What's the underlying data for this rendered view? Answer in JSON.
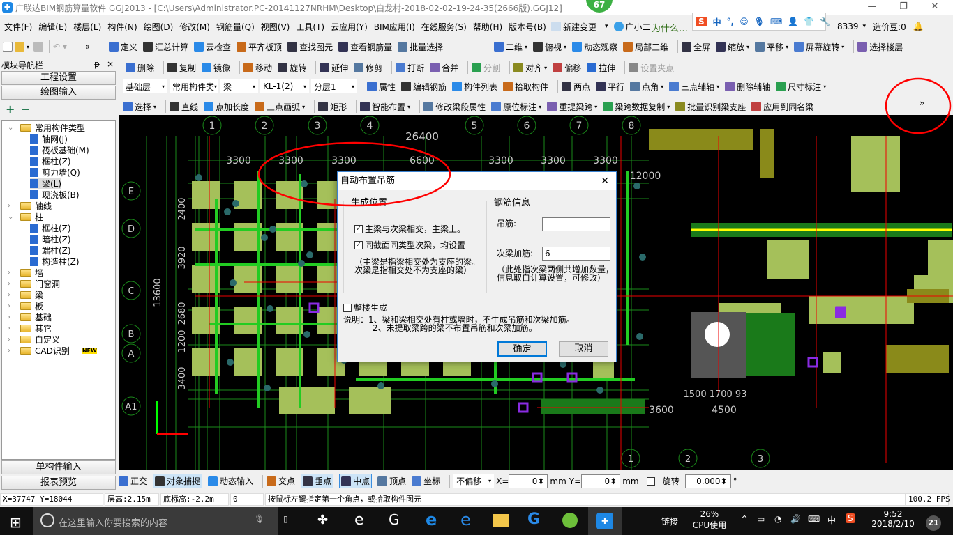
{
  "window": {
    "title": "广联达BIM钢筋算量软件 GGJ2013 - [C:\\Users\\Administrator.PC-20141127NRHM\\Desktop\\白龙村-2018-02-02-19-24-35(2666版).GGJ12]",
    "badge": "67",
    "minimize": "—",
    "restore": "❐",
    "close": "✕"
  },
  "menu": [
    "文件(F)",
    "编辑(E)",
    "楼层(L)",
    "构件(N)",
    "绘图(D)",
    "修改(M)",
    "钢筋量(Q)",
    "视图(V)",
    "工具(T)",
    "云应用(Y)",
    "BIM应用(I)",
    "在线服务(S)",
    "帮助(H)",
    "版本号(B)"
  ],
  "menu_extra": {
    "new_change": "新建变更",
    "assistant": "广小二",
    "ad": "为什么…",
    "account": "8339",
    "beans": "造价豆:0"
  },
  "ime": {
    "lang": "中",
    "punct": "°,"
  },
  "toolbar1": {
    "items": [
      "定义",
      "汇总计算",
      "云检查",
      "平齐板顶",
      "查找图元",
      "查看钢筋量",
      "批量选择"
    ],
    "view_items": [
      "二维",
      "俯视",
      "动态观察",
      "局部三维",
      "全屏",
      "缩放",
      "平移",
      "屏幕旋转",
      "选择楼层"
    ]
  },
  "toolbar2": {
    "items": [
      "删除",
      "复制",
      "镜像",
      "移动",
      "旋转",
      "延伸",
      "修剪",
      "打断",
      "合并",
      "分割",
      "对齐",
      "偏移",
      "拉伸",
      "设置夹点"
    ]
  },
  "toolbar3": {
    "floor": "基础层",
    "category": "常用构件类",
    "type": "梁",
    "component": "KL-1(2)",
    "layer": "分层1",
    "items": [
      "属性",
      "编辑钢筋",
      "构件列表",
      "拾取构件",
      "两点",
      "平行",
      "点角",
      "三点辅轴",
      "删除辅轴",
      "尺寸标注"
    ]
  },
  "toolbar4": {
    "items": [
      "选择",
      "直线",
      "点加长度",
      "三点画弧",
      "矩形",
      "智能布置",
      "修改梁段属性",
      "原位标注",
      "重提梁跨",
      "梁跨数据复制",
      "批量识别梁支座",
      "应用到同名梁"
    ],
    "more": "»"
  },
  "nav": {
    "title": "模块导航栏",
    "pin": "ᵽ",
    "close": "×",
    "btn_project": "工程设置",
    "btn_draw": "绘图输入",
    "expand": "+",
    "collapse": "−",
    "btn_single": "单构件输入",
    "btn_report": "报表预览",
    "tree": [
      {
        "label": "常用构件类型",
        "level": 0,
        "folder": true,
        "open": true
      },
      {
        "label": "轴网(J)",
        "level": 1
      },
      {
        "label": "筏板基础(M)",
        "level": 1
      },
      {
        "label": "框柱(Z)",
        "level": 1
      },
      {
        "label": "剪力墙(Q)",
        "level": 1
      },
      {
        "label": "梁(L)",
        "level": 1,
        "selected": true
      },
      {
        "label": "现浇板(B)",
        "level": 1
      },
      {
        "label": "轴线",
        "level": 0,
        "folder": true
      },
      {
        "label": "柱",
        "level": 0,
        "folder": true,
        "open": true
      },
      {
        "label": "框柱(Z)",
        "level": 1
      },
      {
        "label": "暗柱(Z)",
        "level": 1
      },
      {
        "label": "端柱(Z)",
        "level": 1
      },
      {
        "label": "构造柱(Z)",
        "level": 1
      },
      {
        "label": "墙",
        "level": 0,
        "folder": true
      },
      {
        "label": "门窗洞",
        "level": 0,
        "folder": true
      },
      {
        "label": "梁",
        "level": 0,
        "folder": true
      },
      {
        "label": "板",
        "level": 0,
        "folder": true
      },
      {
        "label": "基础",
        "level": 0,
        "folder": true
      },
      {
        "label": "其它",
        "level": 0,
        "folder": true
      },
      {
        "label": "自定义",
        "level": 0,
        "folder": true
      },
      {
        "label": "CAD识别",
        "level": 0,
        "folder": true,
        "badge": "NEW"
      }
    ]
  },
  "cad": {
    "top_axes": [
      "1",
      "2",
      "3",
      "4",
      "5",
      "6",
      "7",
      "8"
    ],
    "left_axes": [
      "E",
      "D",
      "C",
      "B",
      "A",
      "A1"
    ],
    "bottom_axes": [
      "1",
      "2",
      "3"
    ],
    "dims_top": [
      "26400",
      "3300",
      "3300",
      "3300",
      "6600",
      "3300",
      "3300",
      "3300"
    ],
    "dim_right": "12000",
    "dims_left": [
      "2400",
      "3920",
      "13600",
      "2680",
      "1200",
      "3400"
    ],
    "dims_bottom": [
      "3600",
      "4500",
      "1500 1700 93"
    ]
  },
  "dialog": {
    "title": "自动布置吊筋",
    "close": "✕",
    "group1": "生成位置",
    "opt1": {
      "label": "主梁与次梁相交，主梁上。",
      "checked": true
    },
    "opt2": {
      "label": "同截面同类型次梁，均设置",
      "checked": true
    },
    "note1": "（主梁是指梁相交处为支座的梁。",
    "note2": "次梁是指相交处不为支座的梁）",
    "group2": "钢筋信息",
    "hanger_label": "吊筋:",
    "hanger_value": "",
    "extra_label": "次梁加筋:",
    "extra_value": "6",
    "note3": "（此处指次梁两侧共增加数量，",
    "note4": "信息取自计算设置，可修改）",
    "whole": {
      "label": "整楼生成",
      "checked": false
    },
    "desc1": "说明：1、梁和梁相交处有柱或墙时，不生成吊筋和次梁加筋。",
    "desc2": "2、未提取梁跨的梁不布置吊筋和次梁加筋。",
    "ok": "确定",
    "cancel": "取消"
  },
  "snap": {
    "items": [
      "正交",
      "对象捕捉",
      "动态输入",
      "交点",
      "垂点",
      "中点",
      "顶点",
      "坐标"
    ],
    "offset": "不偏移",
    "x_label": "X=",
    "x": "0",
    "unit": "mm",
    "y_label": "Y=",
    "y": "0",
    "rotate": "旋转",
    "angle": "0.000",
    "deg": "°"
  },
  "status": {
    "coords": "X=37747 Y=18044",
    "floor_h": "层高:2.15m",
    "base_h": "底标高:-2.2m",
    "num": "0",
    "hint": "按鼠标左键指定第一个角点，或拾取构件图元",
    "fps": "100.2 FPS"
  },
  "taskbar": {
    "search": "在这里输入你要搜索的内容",
    "link": "链接",
    "cpu": "26%",
    "cpu_label": "CPU使用",
    "ime": "中",
    "time": "9:52",
    "date": "2018/2/10",
    "notif": "21"
  },
  "colors": {
    "accent": "#0078d7",
    "grid": "#1a8a1a",
    "annotation": "#ff0000",
    "beam": "#22cc22",
    "column": "#a5c05a"
  }
}
